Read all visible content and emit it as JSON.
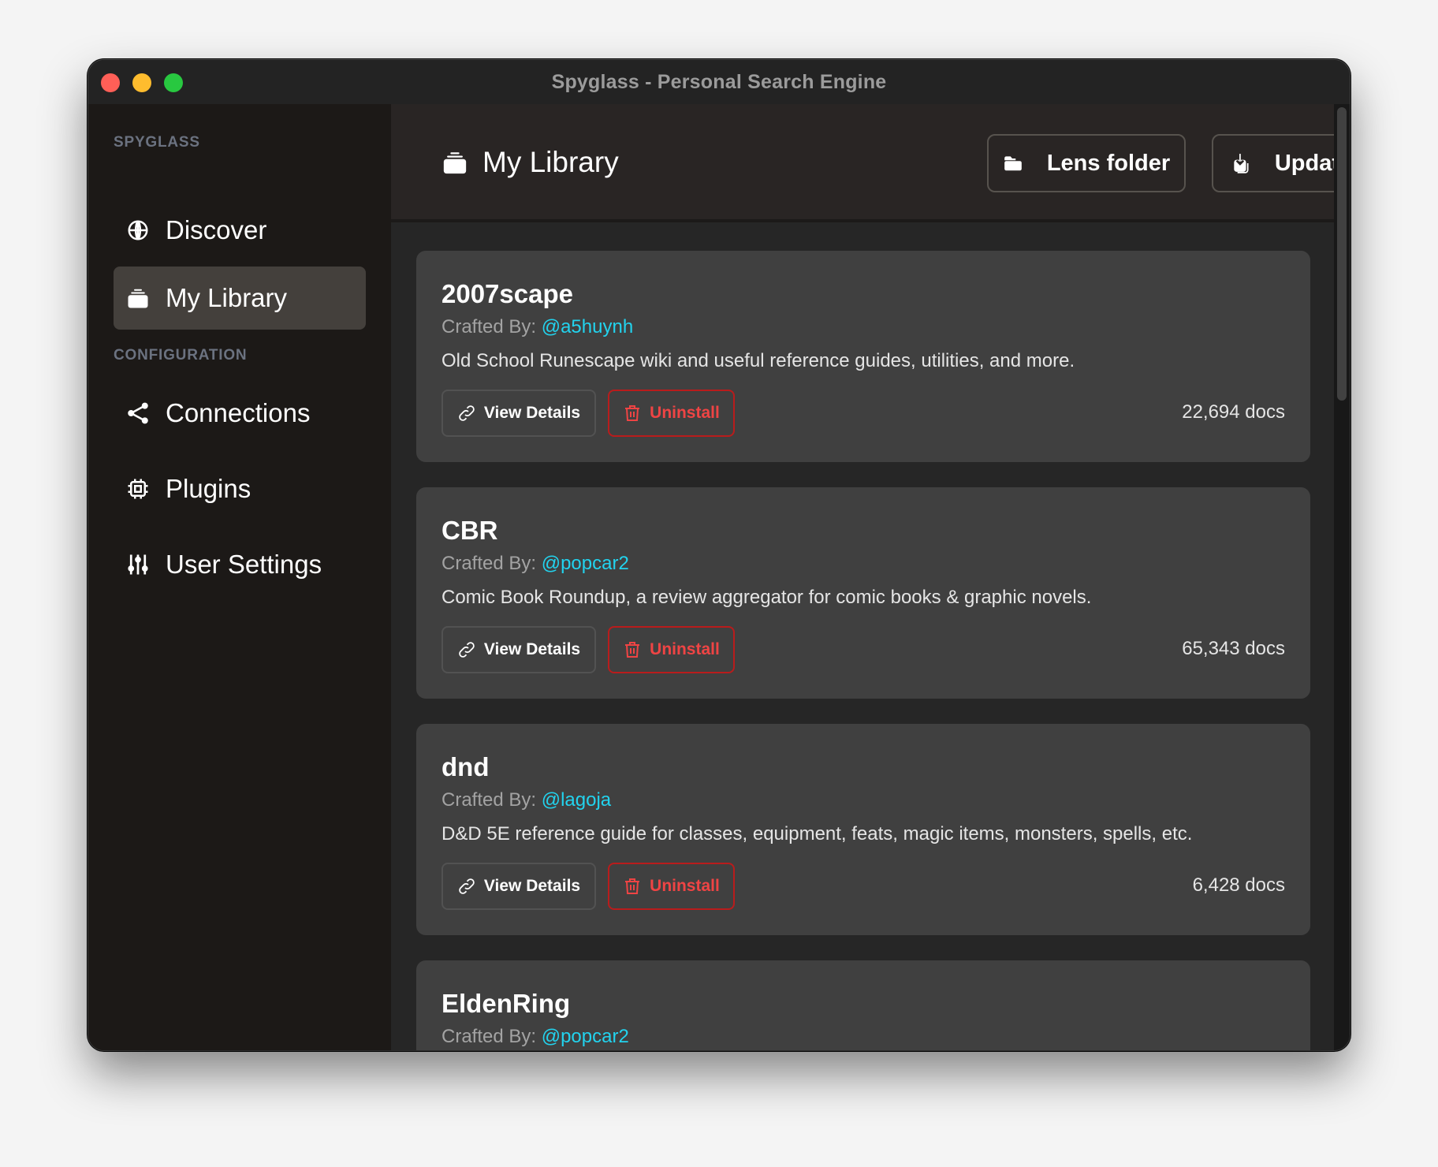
{
  "window": {
    "title": "Spyglass - Personal Search Engine"
  },
  "sidebar": {
    "sections": [
      {
        "label": "SPYGLASS",
        "items": [
          {
            "label": "Discover",
            "icon": "globe-icon",
            "active": false
          },
          {
            "label": "My Library",
            "icon": "library-icon",
            "active": true
          }
        ]
      },
      {
        "label": "CONFIGURATION",
        "items": [
          {
            "label": "Connections",
            "icon": "share-icon",
            "active": false
          },
          {
            "label": "Plugins",
            "icon": "chip-icon",
            "active": false
          },
          {
            "label": "User Settings",
            "icon": "sliders-icon",
            "active": false
          }
        ]
      }
    ]
  },
  "header": {
    "title": "My Library",
    "title_icon": "library-icon",
    "buttons": {
      "lens_folder": {
        "label": "Lens folder",
        "icon": "folder-icon"
      },
      "update": {
        "label": "Update",
        "icon": "download-icon"
      }
    }
  },
  "colors": {
    "accent_link": "#22d3ee",
    "danger": "#ef4444",
    "danger_border": "#b91c1c",
    "active_nav": "#44403c"
  },
  "lenses": [
    {
      "name": "2007scape",
      "crafted_by_label": "Crafted By:",
      "author": "@a5huynh",
      "description": "Old School Runescape wiki and useful reference guides, utilities, and more.",
      "view_details_label": "View Details",
      "uninstall_label": "Uninstall",
      "docs": "22,694 docs"
    },
    {
      "name": "CBR",
      "crafted_by_label": "Crafted By:",
      "author": "@popcar2",
      "description": "Comic Book Roundup, a review aggregator for comic books & graphic novels.",
      "view_details_label": "View Details",
      "uninstall_label": "Uninstall",
      "docs": "65,343 docs"
    },
    {
      "name": "dnd",
      "crafted_by_label": "Crafted By:",
      "author": "@lagoja",
      "description": "D&D 5E reference guide for classes, equipment, feats, magic items, monsters, spells, etc.",
      "view_details_label": "View Details",
      "uninstall_label": "Uninstall",
      "docs": "6,428 docs"
    },
    {
      "name": "EldenRing",
      "crafted_by_label": "Crafted By:",
      "author": "@popcar2"
    }
  ]
}
